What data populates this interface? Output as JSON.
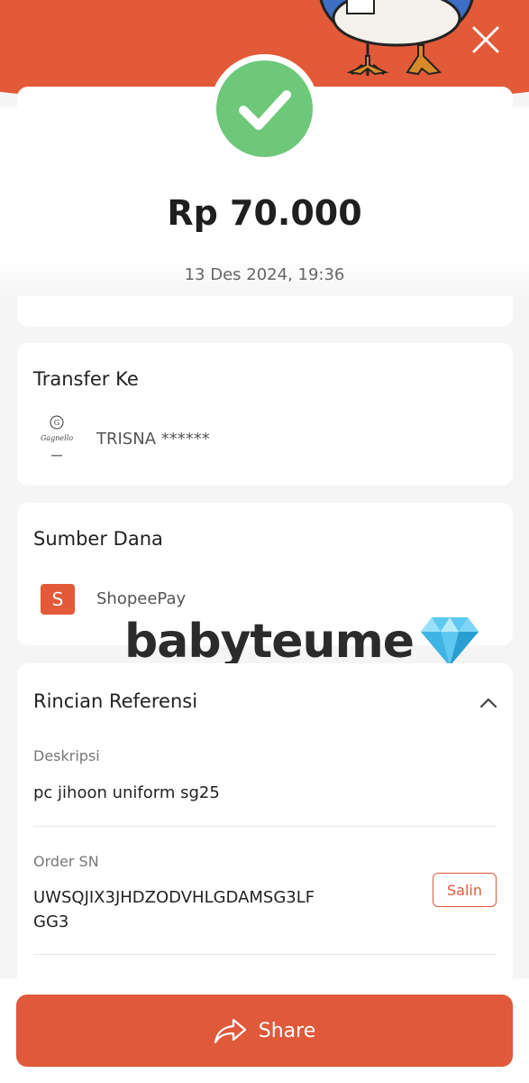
{
  "summary": {
    "amount": "Rp 70.000",
    "datetime": "13 Des 2024, 19:36"
  },
  "transfer": {
    "title": "Transfer Ke",
    "recipient": "TRISNA ******",
    "logo_text": "Gagnello"
  },
  "source": {
    "title": "Sumber Dana",
    "method": "ShopeePay",
    "icon_letter": "S"
  },
  "reference": {
    "title": "Rincian Referensi",
    "description_label": "Deskripsi",
    "description_value": "pc jihoon uniform sg25",
    "order_label": "Order SN",
    "order_value_line1": "UWSQJIX3JHDZODVHLGDAMSG3LF",
    "order_value_line2": "GG3",
    "copy_label": "Salin"
  },
  "watermark": {
    "text": "babyteume"
  },
  "actions": {
    "share_label": "Share"
  },
  "colors": {
    "brand_orange": "#e35a38",
    "success_green": "#6dc87a"
  }
}
